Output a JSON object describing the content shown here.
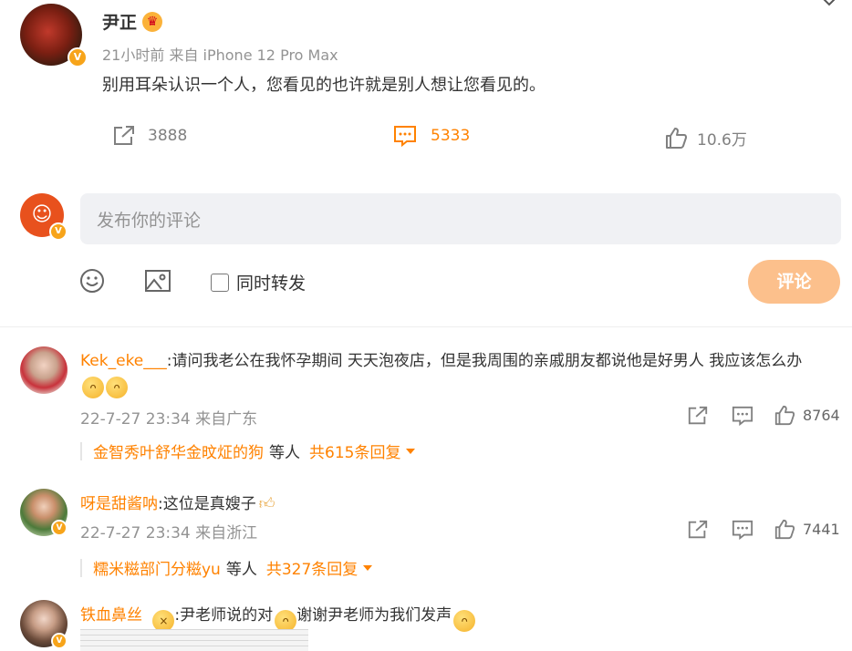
{
  "post": {
    "author": "尹正",
    "meta": "21小时前 来自 iPhone 12 Pro Max",
    "content": "别用耳朵认识一个人，您看见的也许就是别人想让您看见的。",
    "share_count": "3888",
    "comment_count": "5333",
    "like_count": "10.6万"
  },
  "composer": {
    "placeholder": "发布你的评论",
    "repost_label": "同时转发",
    "submit_label": "评论"
  },
  "comments": [
    {
      "user": "Kek_eke___",
      "text": ":请问我老公在我怀孕期间 天天泡夜店，但是我周围的亲戚朋友都说他是好男人 我应该怎么办",
      "meta": "22-7-27 23:34 来自广东",
      "likes": "8764",
      "reply_users": "金智秀叶舒华金旼炡的狗",
      "reply_mid": "等人",
      "reply_total": "共615条回复"
    },
    {
      "user": "呀是甜酱呐",
      "text": ":这位是真嫂子",
      "meta": "22-7-27 23:34 来自浙江",
      "likes": "7441",
      "reply_users": "糯米糍部门分糍yu",
      "reply_mid": "等人",
      "reply_total": "共327条回复"
    },
    {
      "user": "铁血鼻丝",
      "text1": ":尹老师说的对",
      "text2": "谢谢尹老师为我们发声"
    }
  ],
  "colors": {
    "accent": "#ff8200",
    "submit_bg": "#fcc08c"
  }
}
